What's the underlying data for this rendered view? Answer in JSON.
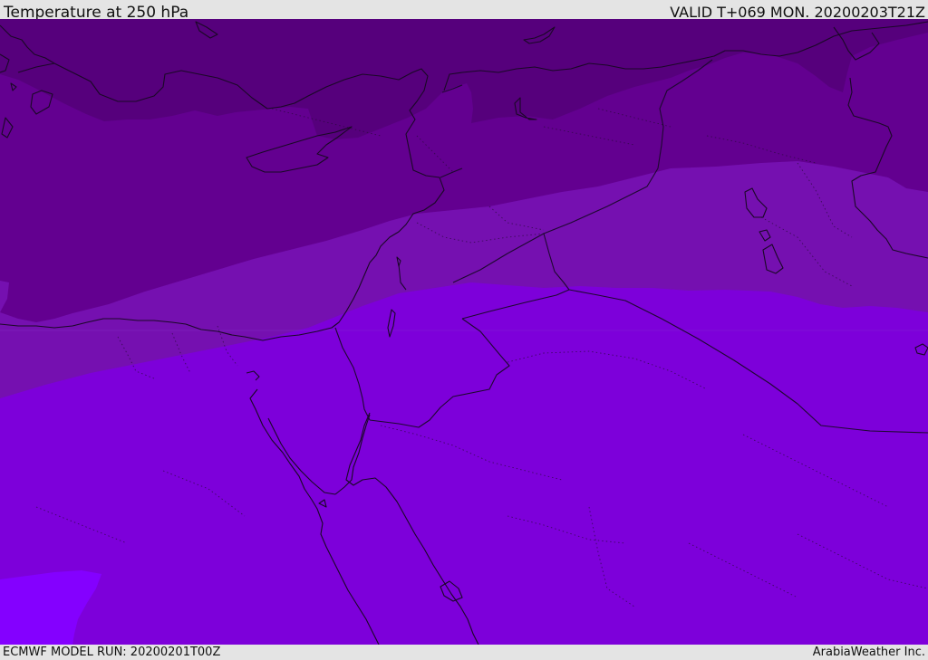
{
  "header": {
    "title": "Temperature at 250 hPa",
    "valid_time": "VALID T+069 MON. 20200203T21Z"
  },
  "footer": {
    "model_run": "ECMWF MODEL RUN: 20200201T00Z",
    "credit": "ArabiaWeather Inc."
  },
  "map": {
    "colors": {
      "band_darkest": "#56007c",
      "band_dark": "#630090",
      "band_mid": "#7510b0",
      "band_main": "#7d00da",
      "band_bright": "#8400ff",
      "coastline": "#1a0826",
      "border": "#2a0a3c"
    }
  }
}
